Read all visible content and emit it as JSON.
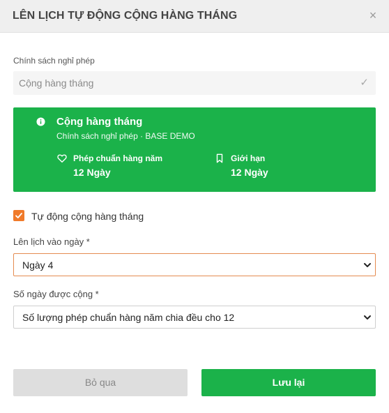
{
  "dialog": {
    "title": "LÊN LỊCH TỰ ĐỘNG CỘNG HÀNG THÁNG",
    "close_glyph": "×"
  },
  "policy": {
    "label": "Chính sách nghỉ phép",
    "value": "Cộng hàng tháng",
    "check_glyph": "✓"
  },
  "info_card": {
    "title": "Cộng hàng tháng",
    "subtitle": "Chính sách nghỉ phép · BASE DEMO",
    "stats": [
      {
        "icon": "heart-icon",
        "label": "Phép chuẩn hàng năm",
        "value": "12 Ngày"
      },
      {
        "icon": "bookmark-icon",
        "label": "Giới hạn",
        "value": "12 Ngày"
      }
    ],
    "color": "#1bb24a"
  },
  "auto_add": {
    "label": "Tự động cộng hàng tháng",
    "checked": true,
    "color": "#f07a2a"
  },
  "schedule_day": {
    "label": "Lên lịch vào ngày *",
    "value": "Ngày 4"
  },
  "days_added": {
    "label": "Số ngày được cộng *",
    "value": "Số lượng phép chuẩn hàng năm chia đều cho 12"
  },
  "actions": {
    "cancel_label": "Bỏ qua",
    "save_label": "Lưu lại"
  }
}
